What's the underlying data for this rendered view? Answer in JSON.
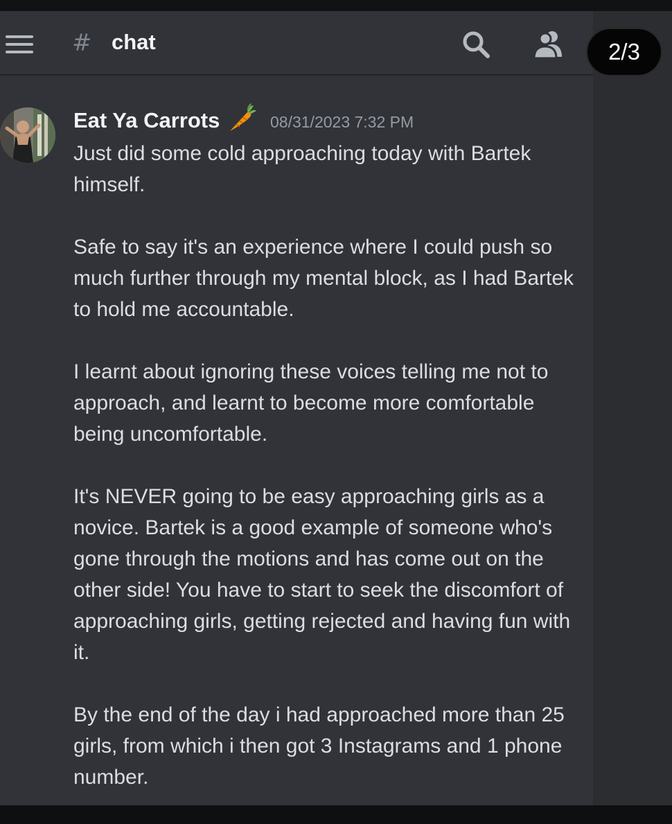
{
  "header": {
    "menu_icon": "hamburger-menu-icon",
    "hash_symbol": "#",
    "channel_name": "chat",
    "search_icon": "search-icon",
    "members_icon": "members-icon"
  },
  "page_indicator": "2/3",
  "message": {
    "author": "Eat Ya Carrots",
    "author_emoji": "carrot-icon",
    "timestamp": "08/31/2023 7:32 PM",
    "paragraphs": [
      "Just did some cold approaching today with Bartek himself.",
      "Safe to say it's an experience where I could push so much further through my mental block, as I had Bartek to hold me accountable.",
      "I learnt about ignoring these voices telling me not to approach, and learnt to become more comfortable being uncomfortable.",
      "It's NEVER going to be easy approaching girls as a novice. Bartek is a good example of someone who's gone through the motions and has come out on the other side! You have to start to seek the discomfort of approaching girls, getting rejected and having fun with it.",
      "By the end of the day i had approached more than 25 girls, from which i then got 3 Instagrams and 1 phone number."
    ]
  },
  "colors": {
    "background": "#313338",
    "header_text": "#f2f3f5",
    "body_text": "#dbdee1",
    "timestamp": "#949ba4",
    "icon": "#b5bac1"
  }
}
